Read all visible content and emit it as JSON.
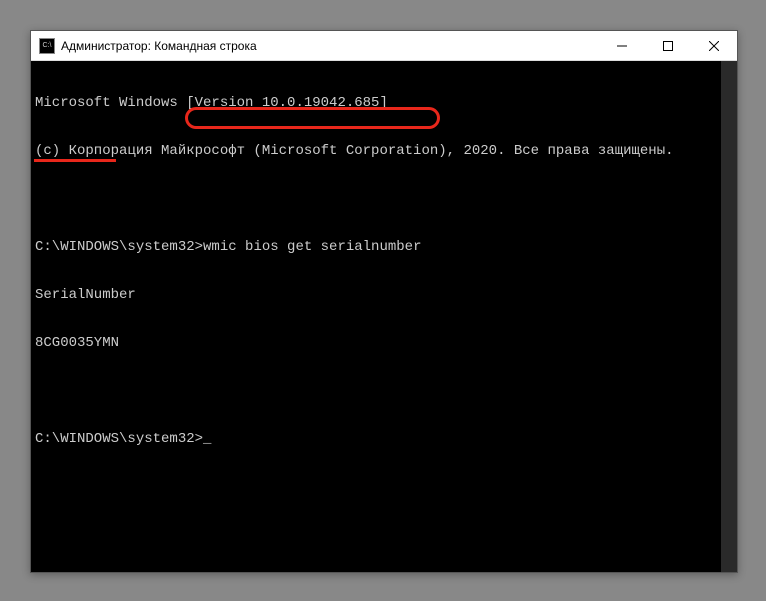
{
  "window": {
    "title": "Администратор: Командная строка",
    "icon_text": "C:\\"
  },
  "terminal": {
    "line1": "Microsoft Windows [Version 10.0.19042.685]",
    "line2": "(c) Корпорация Майкрософт (Microsoft Corporation), 2020. Все права защищены.",
    "blank1": "",
    "prompt1_path": "C:\\WINDOWS\\system32>",
    "command1": "wmic bios get serialnumber",
    "output_header": "SerialNumber",
    "output_value": "8CG0035YMN",
    "blank2": "",
    "prompt2_path": "C:\\WINDOWS\\system32>",
    "cursor": "_"
  }
}
